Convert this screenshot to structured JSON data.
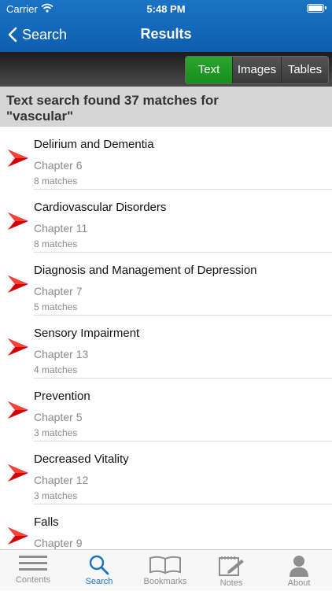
{
  "status_bar": {
    "carrier": "Carrier",
    "time": "5:48 PM"
  },
  "nav": {
    "back_label": "Search",
    "title": "Results"
  },
  "segments": {
    "text": "Text",
    "images": "Images",
    "tables": "Tables",
    "selected": "Text"
  },
  "summary": {
    "line1": "Text search found 37 matches for",
    "line2": "\"vascular\""
  },
  "results": [
    {
      "title": "Delirium and Dementia",
      "chapter": "Chapter 6",
      "matches": "8 matches"
    },
    {
      "title": "Cardiovascular Disorders",
      "chapter": "Chapter 11",
      "matches": "8 matches"
    },
    {
      "title": "Diagnosis and Management of Depression",
      "chapter": "Chapter 7",
      "matches": "5 matches"
    },
    {
      "title": "Sensory Impairment",
      "chapter": "Chapter 13",
      "matches": "4 matches"
    },
    {
      "title": "Prevention",
      "chapter": "Chapter 5",
      "matches": "3 matches"
    },
    {
      "title": "Decreased Vitality",
      "chapter": "Chapter 12",
      "matches": "3 matches"
    },
    {
      "title": "Falls",
      "chapter": "Chapter 9",
      "matches": ""
    }
  ],
  "tabbar": {
    "contents": "Contents",
    "search": "Search",
    "bookmarks": "Bookmarks",
    "notes": "Notes",
    "about": "About",
    "selected": "Search"
  },
  "colors": {
    "nav_blue": "#1a6ec2",
    "segment_green": "#1f9a22",
    "arrow_red": "#d40000",
    "tab_active": "#1a72c6"
  },
  "icons": {
    "back": "chevron-left-icon",
    "result": "red-arrow-icon"
  }
}
